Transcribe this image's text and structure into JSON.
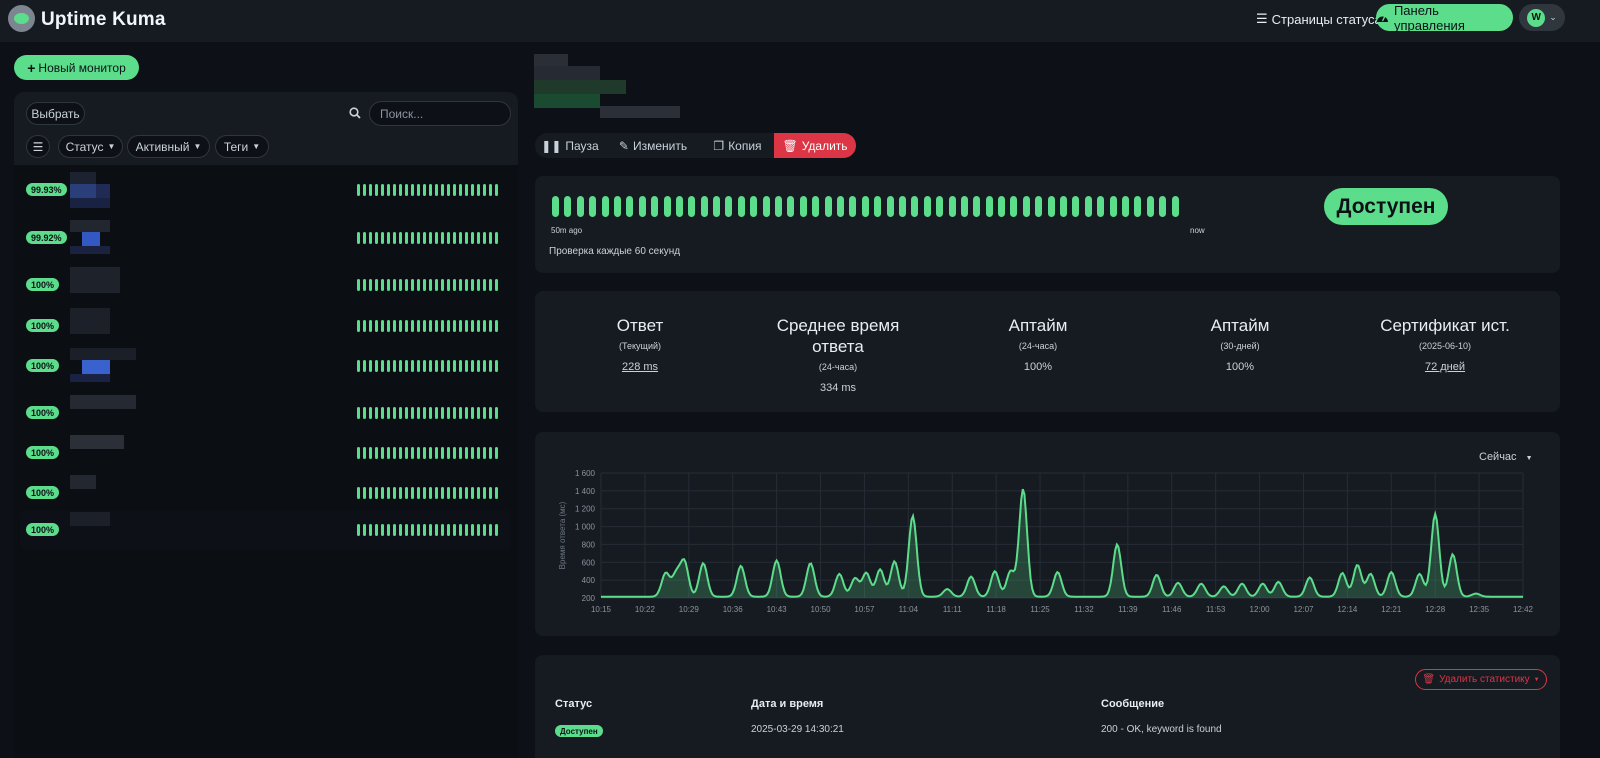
{
  "header": {
    "brand": "Uptime Kuma",
    "status_pages": "Страницы статуса",
    "dashboard": "Панель управления",
    "avatar_letter": "W"
  },
  "sidebar": {
    "new_monitor": "Новый монитор",
    "select": "Выбрать",
    "search_placeholder": "Поиск...",
    "filters": {
      "status": "Статус",
      "active": "Активный",
      "tags": "Теги"
    },
    "monitors": [
      {
        "uptime": "99.93%",
        "active": false
      },
      {
        "uptime": "99.92%",
        "active": false
      },
      {
        "uptime": "100%",
        "active": false
      },
      {
        "uptime": "100%",
        "active": false
      },
      {
        "uptime": "100%",
        "active": false
      },
      {
        "uptime": "100%",
        "active": false
      },
      {
        "uptime": "100%",
        "active": false
      },
      {
        "uptime": "100%",
        "active": false
      },
      {
        "uptime": "100%",
        "active": true
      }
    ]
  },
  "toolbar": {
    "pause": "Пауза",
    "edit": "Изменить",
    "clone": "Копия",
    "delete": "Удалить"
  },
  "heartbeat": {
    "start_label": "50m ago",
    "end_label": "now",
    "interval_text": "Проверка каждые 60 секунд",
    "status_badge": "Доступен"
  },
  "stats": [
    {
      "title": "Ответ",
      "sub": "(Текущий)",
      "value": "228 ms"
    },
    {
      "title": "Среднее время ответа",
      "sub": "(24-часа)",
      "value": "334 ms"
    },
    {
      "title": "Аптайм",
      "sub": "(24-часа)",
      "value": "100%"
    },
    {
      "title": "Аптайм",
      "sub": "(30-дней)",
      "value": "100%"
    },
    {
      "title": "Сертификат ист.",
      "sub": "(2025-06-10)",
      "value": "72 дней"
    }
  ],
  "chart_range": "Сейчас",
  "chart_data": {
    "type": "area",
    "ylabel": "Время ответа (мс)",
    "ylim": [
      200,
      1600
    ],
    "yticks": [
      200,
      400,
      600,
      800,
      "1 000",
      "1 200",
      "1 400",
      "1 600"
    ],
    "xticks": [
      "10:15",
      "10:22",
      "10:29",
      "10:36",
      "10:43",
      "10:50",
      "10:57",
      "11:04",
      "11:11",
      "11:18",
      "11:25",
      "11:32",
      "11:39",
      "11:46",
      "11:53",
      "12:00",
      "12:07",
      "12:14",
      "12:21",
      "12:28",
      "12:35",
      "12:42"
    ],
    "peaks": [
      {
        "t": 10.2,
        "v": 380
      },
      {
        "t": 10.5,
        "v": 320
      },
      {
        "t": 12.0,
        "v": 460
      },
      {
        "t": 13.3,
        "v": 600
      },
      {
        "t": 16.3,
        "v": 590
      },
      {
        "t": 22.3,
        "v": 560
      },
      {
        "t": 28.0,
        "v": 620
      },
      {
        "t": 33.4,
        "v": 590
      },
      {
        "t": 38.0,
        "v": 470
      },
      {
        "t": 40.5,
        "v": 420
      },
      {
        "t": 42.3,
        "v": 480
      },
      {
        "t": 44.5,
        "v": 520
      },
      {
        "t": 46.8,
        "v": 610
      },
      {
        "t": 49.7,
        "v": 1120
      },
      {
        "t": 55.2,
        "v": 300
      },
      {
        "t": 59.0,
        "v": 440
      },
      {
        "t": 62.8,
        "v": 500
      },
      {
        "t": 65.3,
        "v": 500
      },
      {
        "t": 67.3,
        "v": 1420
      },
      {
        "t": 72.8,
        "v": 490
      },
      {
        "t": 82.3,
        "v": 800
      },
      {
        "t": 88.6,
        "v": 460
      },
      {
        "t": 92.0,
        "v": 370
      },
      {
        "t": 95.7,
        "v": 360
      },
      {
        "t": 99.3,
        "v": 330
      },
      {
        "t": 102.2,
        "v": 360
      },
      {
        "t": 105.5,
        "v": 360
      },
      {
        "t": 108.0,
        "v": 380
      },
      {
        "t": 113.0,
        "v": 430
      },
      {
        "t": 118.2,
        "v": 480
      },
      {
        "t": 120.6,
        "v": 570
      },
      {
        "t": 122.7,
        "v": 470
      },
      {
        "t": 126.0,
        "v": 490
      },
      {
        "t": 130.5,
        "v": 470
      },
      {
        "t": 133.0,
        "v": 1140
      },
      {
        "t": 135.8,
        "v": 690
      },
      {
        "t": 139.5,
        "v": 250
      }
    ]
  },
  "events": {
    "delete_stats": "Удалить статистику",
    "columns": [
      "Статус",
      "Дата и время",
      "Сообщение"
    ],
    "rows": [
      {
        "status": "Доступен",
        "datetime": "2025-03-29 14:30:21",
        "message": "200 - OK, keyword is found"
      }
    ]
  },
  "colors": {
    "accent": "#5cdd8b",
    "danger": "#dc3545",
    "bg": "#0d1117",
    "card": "#161b22"
  }
}
